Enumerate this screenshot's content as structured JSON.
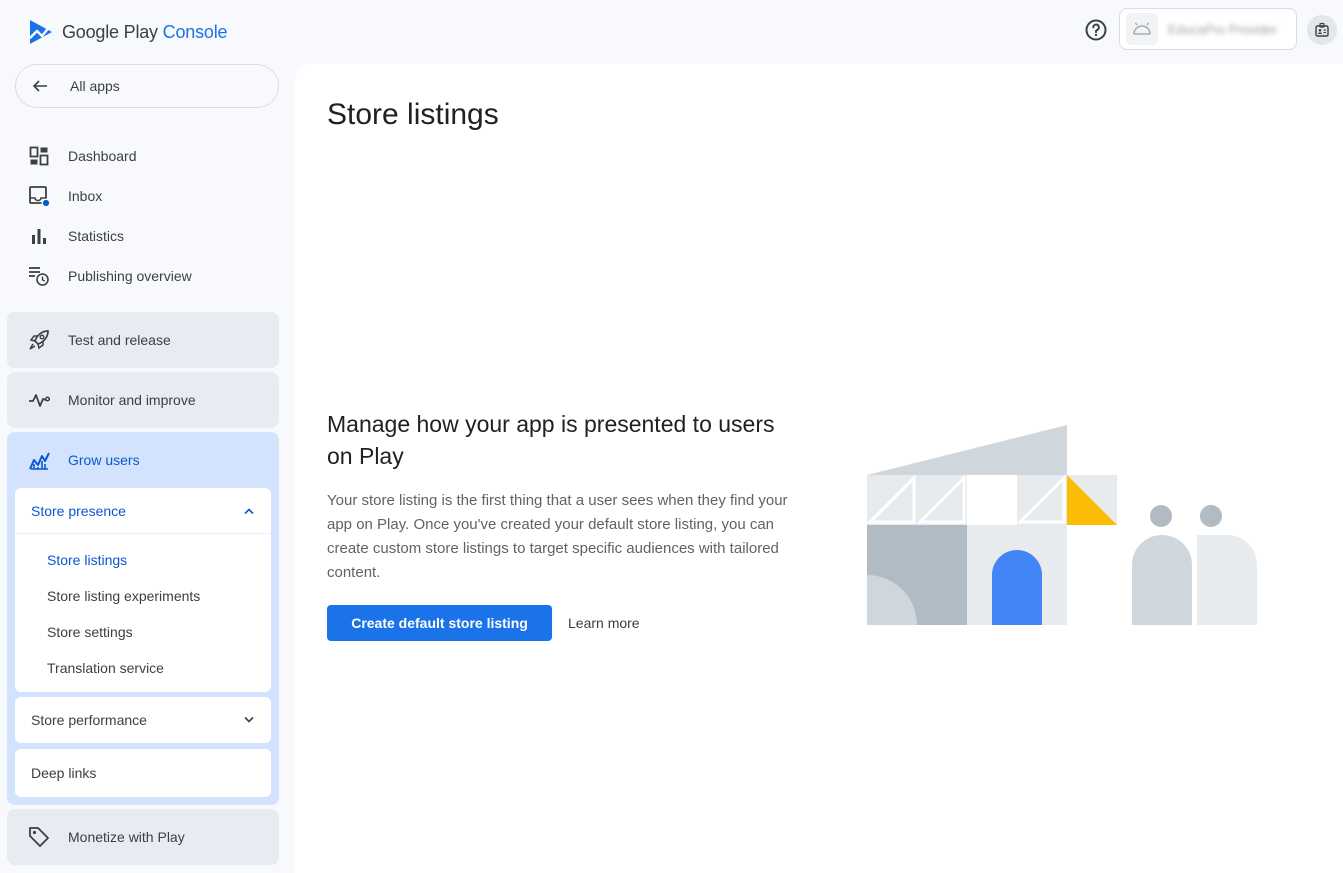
{
  "header": {
    "logo_google_play": "Google Play ",
    "logo_console": "Console",
    "account_name": "EducaPro Provider",
    "help_icon": "help-circle-icon",
    "profile_icon": "account-badge-icon"
  },
  "sidebar": {
    "all_apps_label": "All apps",
    "items": [
      {
        "label": "Dashboard",
        "icon": "dashboard-icon"
      },
      {
        "label": "Inbox",
        "icon": "inbox-icon"
      },
      {
        "label": "Statistics",
        "icon": "bar-chart-icon"
      },
      {
        "label": "Publishing overview",
        "icon": "publishing-overview-icon"
      }
    ],
    "sections": [
      {
        "label": "Test and release",
        "icon": "rocket-icon"
      },
      {
        "label": "Monitor and improve",
        "icon": "vitals-icon"
      },
      {
        "label": "Grow users",
        "icon": "grow-users-icon"
      },
      {
        "label": "Monetize with Play",
        "icon": "tag-icon"
      }
    ],
    "store_presence": {
      "label": "Store presence",
      "links": [
        "Store listings",
        "Store listing experiments",
        "Store settings",
        "Translation service"
      ]
    },
    "store_performance": "Store performance",
    "deep_links": "Deep links"
  },
  "main": {
    "title": "Store listings",
    "empty_heading": "Manage how your app is presented to users on Play",
    "empty_body": "Your store listing is the first thing that a user sees when they find your app on Play. Once you've created your default store listing, you can create custom store listings to target specific audiences with tailored content.",
    "primary_button": "Create default store listing",
    "learn_more": "Learn more"
  },
  "colors": {
    "accent": "#1a73e8",
    "sidebar_active_bg": "#d3e3fd",
    "section_bg": "#e8ebf1",
    "illustration_yellow": "#fbbc04",
    "illustration_blue": "#4285f4"
  }
}
